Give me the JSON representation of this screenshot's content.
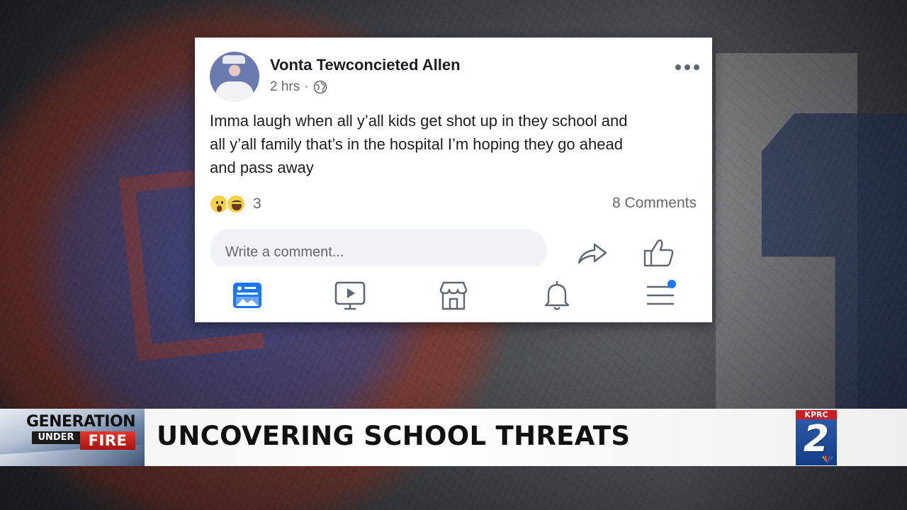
{
  "post": {
    "author": "Vonta Tewconcieted Allen",
    "time": "2 hrs",
    "separator": "·",
    "body_lines": [
      "Imma laugh when all y’all kids get shot up in they school and",
      "all y’all family that’s in the hospital I’m hoping they go ahead",
      "and pass away"
    ],
    "reaction_count": "3",
    "comments": "8 Comments",
    "comment_placeholder": "Write a comment...",
    "icons": {
      "more": "more-options-icon",
      "audience": "globe-icon",
      "reactions": [
        "wow-reaction-icon",
        "haha-reaction-icon"
      ],
      "share": "share-icon",
      "like": "like-icon"
    }
  },
  "nav": {
    "items": [
      "news-feed-icon",
      "watch-icon",
      "marketplace-icon",
      "notifications-icon",
      "menu-icon"
    ],
    "accent": "#1877f2"
  },
  "banner": {
    "logo_line1": "GENERATION",
    "logo_line2": "UNDER",
    "logo_line3": "FIRE",
    "headline": "UNCOVERING SCHOOL THREATS",
    "station_call": "KPRC",
    "station_number": "2"
  },
  "colors": {
    "fb_text": "#1c1e21",
    "fb_secondary": "#65676b",
    "fb_blue": "#1877f2",
    "fire_red": "#c81e23",
    "station_blue": "#143c86"
  }
}
